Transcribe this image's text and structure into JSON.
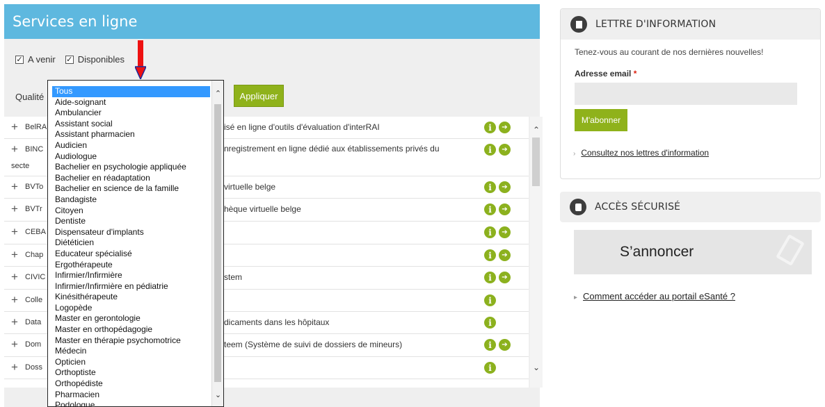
{
  "main": {
    "title": "Services en ligne",
    "filters": {
      "a_venir": "A venir",
      "disponibles": "Disponibles"
    },
    "quality_label": "Qualité",
    "apply_label": "Appliquer"
  },
  "dropdown": {
    "selected": "Tous",
    "options": [
      "Tous",
      "Aide-soignant",
      "Ambulancier",
      "Assistant social",
      "Assistant pharmacien",
      "Audicien",
      "Audiologue",
      "Bachelier en psychologie appliquée",
      "Bachelier en réadaptation",
      "Bachelier en science de la famille",
      "Bandagiste",
      "Citoyen",
      "Dentiste",
      "Dispensateur d'implants",
      "Diététicien",
      "Educateur spécialisé",
      "Ergothérapeute",
      "Infirmier/Infirmière",
      "Infirmier/Infirmière en pédiatrie",
      "Kinésithérapeute",
      "Logopède",
      "Master en gerontologie",
      "Master en orthopédagogie",
      "Master en thérapie psychomotrice",
      "Médecin",
      "Opticien",
      "Orthoptiste",
      "Orthopédiste",
      "Pharmacien",
      "Podologue"
    ]
  },
  "services": [
    {
      "name": "BelRA",
      "desc": "isé en ligne d'outils d'évaluation d'interRAI",
      "info": true,
      "go": true
    },
    {
      "name": "BINC",
      "name2": "secte",
      "desc": "nregistrement en ligne dédié aux établissements privés du",
      "info": true,
      "go": true
    },
    {
      "name": "BVTo",
      "desc": "virtuelle belge",
      "info": true,
      "go": true
    },
    {
      "name": "BVTr",
      "desc": "hèque virtuelle belge",
      "info": true,
      "go": true
    },
    {
      "name": "CEBA",
      "desc": "",
      "info": true,
      "go": true
    },
    {
      "name": "Chap",
      "desc": "",
      "info": true,
      "go": true
    },
    {
      "name": "CIVIC",
      "desc": "stem",
      "info": true,
      "go": true
    },
    {
      "name": "Colle",
      "desc": "",
      "info": true,
      "go": false
    },
    {
      "name": "Data",
      "desc": "dicaments dans les hôpitaux",
      "info": true,
      "go": false
    },
    {
      "name": "Dom",
      "desc": "teem (Système de suivi de dossiers de mineurs)",
      "info": true,
      "go": true
    },
    {
      "name": "Doss",
      "desc": "",
      "info": true,
      "go": false
    }
  ],
  "newsletter": {
    "title": "LETTRE D'INFORMATION",
    "intro": "Tenez-vous au courant de nos dernières nouvelles!",
    "email_label": "Adresse email",
    "required_mark": "*",
    "subscribe": "M'abonner",
    "link": "Consultez nos lettres d'information"
  },
  "secure": {
    "title": "ACCÈS SÉCURISÉ",
    "login": "S’annoncer",
    "link": "Comment accéder au portail eSanté ?"
  },
  "icons": {
    "info": "info-icon",
    "go": "arrow-right-icon"
  }
}
